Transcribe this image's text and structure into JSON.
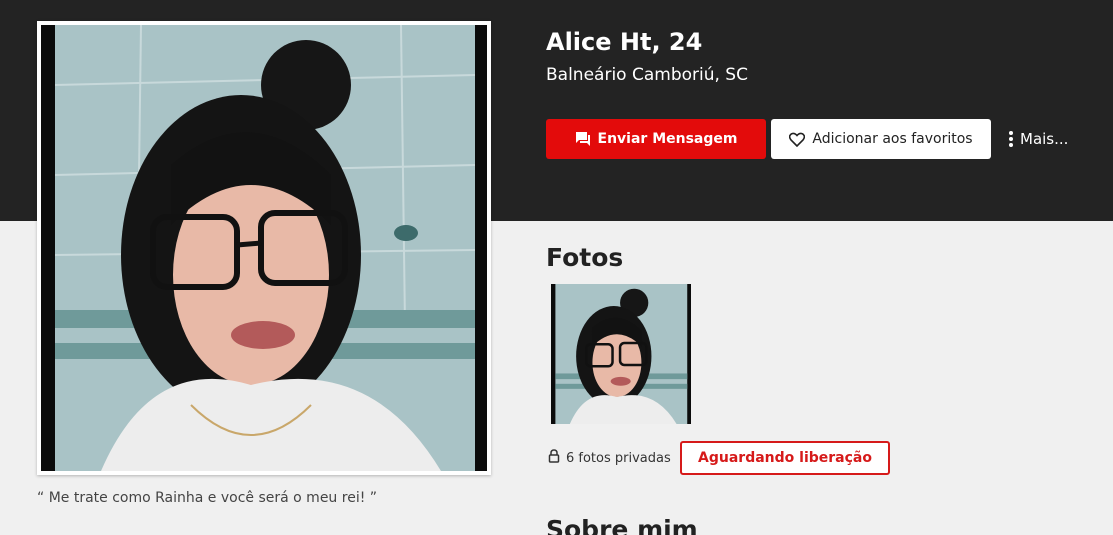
{
  "profile": {
    "name": "Alice Ht, 24",
    "location": "Balneário Camboriú, SC",
    "quote": "“ Me trate como Rainha e você será o meu rei! ”",
    "photo_icon": "profile-portrait-photo"
  },
  "actions": {
    "send_message_label": "Enviar Mensagem",
    "send_message_icon": "chat-bubble-icon",
    "favorite_label": "Adicionar aos favoritos",
    "favorite_icon": "heart-outline-icon",
    "more_label": "Mais...",
    "more_icon": "kebab-menu-icon"
  },
  "photos": {
    "title": "Fotos",
    "private_text": "6 fotos privadas",
    "private_icon": "lock-icon",
    "pending_label": "Aguardando liberação"
  },
  "about": {
    "title": "Sobre mim"
  },
  "colors": {
    "header_bg": "#232323",
    "accent_red": "#e30b0b",
    "page_bg": "#f0f0f0"
  }
}
